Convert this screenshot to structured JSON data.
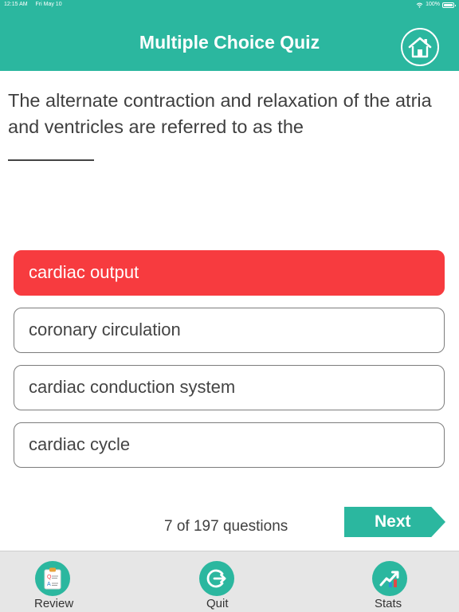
{
  "status_bar": {
    "time": "12:15 AM",
    "date": "Fri May 10",
    "battery": "100%"
  },
  "header": {
    "title": "Multiple Choice Quiz",
    "home_icon": "home-icon"
  },
  "question": {
    "text": "The alternate contraction and relaxation of the atria and ventricles are referred to as the"
  },
  "answers": [
    {
      "label": "cardiac output",
      "selected": true
    },
    {
      "label": "coronary circulation",
      "selected": false
    },
    {
      "label": "cardiac conduction system",
      "selected": false
    },
    {
      "label": "cardiac cycle",
      "selected": false
    }
  ],
  "progress": {
    "text": "7 of 197 questions",
    "current": 7,
    "total": 197
  },
  "next_button": {
    "label": "Next"
  },
  "tabs": [
    {
      "label": "Review",
      "icon": "review-clipboard-icon"
    },
    {
      "label": "Quit",
      "icon": "quit-exit-icon"
    },
    {
      "label": "Stats",
      "icon": "stats-chart-icon"
    }
  ],
  "colors": {
    "accent": "#2bb79f",
    "selected_answer": "#f73b3f",
    "tab_bar": "#e6e6e6"
  }
}
